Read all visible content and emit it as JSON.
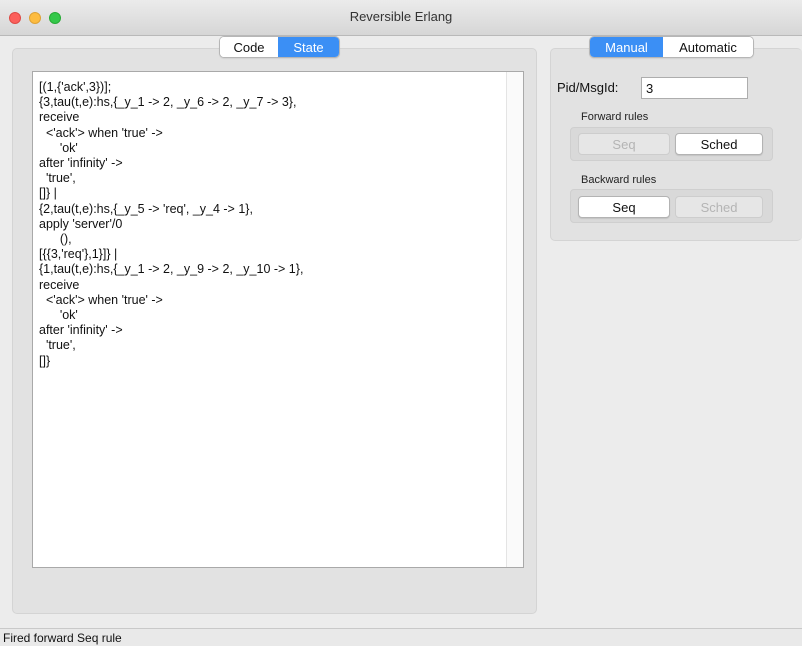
{
  "window": {
    "title": "Reversible Erlang"
  },
  "left_tabs": [
    {
      "label": "Code",
      "active": false
    },
    {
      "label": "State",
      "active": true
    }
  ],
  "right_tabs": [
    {
      "label": "Manual",
      "active": true
    },
    {
      "label": "Automatic",
      "active": false
    }
  ],
  "state_lines": [
    "[(1,{'ack',3})];",
    "{3,tau(t,e):hs,{_y_1 -> 2, _y_6 -> 2, _y_7 -> 3},",
    "receive",
    "  <'ack'> when 'true' ->",
    "      'ok'",
    "after 'infinity' ->",
    "  'true',",
    "[]} |",
    "{2,tau(t,e):hs,{_y_5 -> 'req', _y_4 -> 1},",
    "apply 'server'/0",
    "      (),",
    "[{{3,'req'},1}]} |",
    "{1,tau(t,e):hs,{_y_1 -> 2, _y_9 -> 2, _y_10 -> 1},",
    "receive",
    "  <'ack'> when 'true' ->",
    "      'ok'",
    "after 'infinity' ->",
    "  'true',",
    "[]}"
  ],
  "pid_field": {
    "label": "Pid/MsgId:",
    "value": "3"
  },
  "forward_rules": {
    "label": "Forward rules",
    "seq": {
      "label": "Seq",
      "enabled": false
    },
    "sched": {
      "label": "Sched",
      "enabled": true
    }
  },
  "backward_rules": {
    "label": "Backward rules",
    "seq": {
      "label": "Seq",
      "enabled": true
    },
    "sched": {
      "label": "Sched",
      "enabled": false
    }
  },
  "status": {
    "text": "Fired forward Seq rule"
  },
  "colors": {
    "accent": "#3b8ff5",
    "close": "#fc605c",
    "minimize": "#fdbc40",
    "maximize": "#34c84a"
  }
}
